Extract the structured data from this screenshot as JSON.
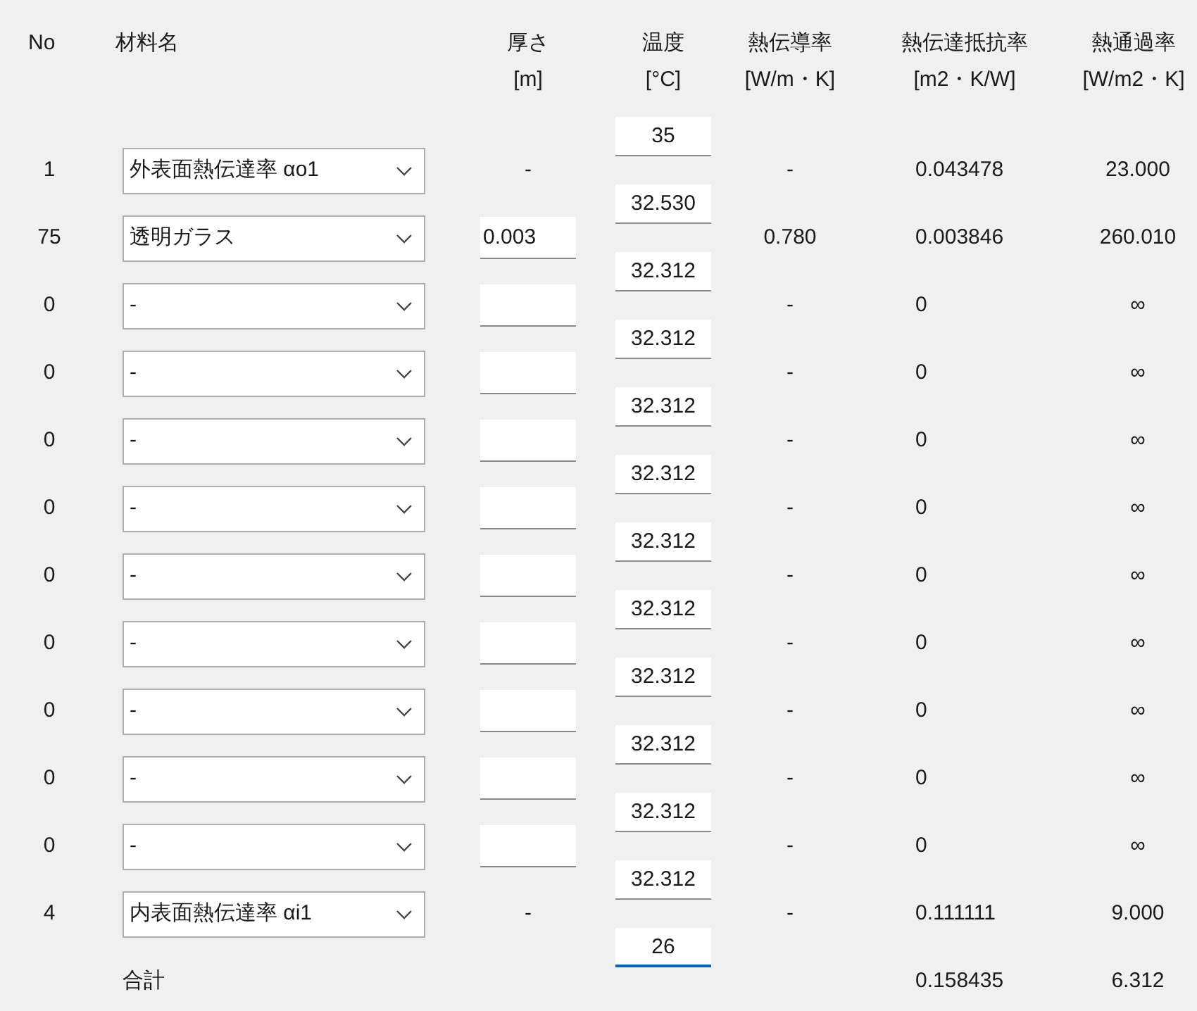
{
  "headers": [
    {
      "lines": [
        "No"
      ]
    },
    {
      "lines": [
        "材料名"
      ]
    },
    {
      "lines": [
        "厚さ",
        "[m]"
      ]
    },
    {
      "lines": [
        "温度",
        "[°C]"
      ]
    },
    {
      "lines": [
        "熱伝導率",
        "[W/m・K]"
      ]
    },
    {
      "lines": [
        "熱伝達抵抗率",
        "[m2・K/W]"
      ]
    },
    {
      "lines": [
        "熱通過率",
        "[W/m2・K]"
      ]
    }
  ],
  "rows": [
    {
      "no": "1",
      "material": "外表面熱伝達率 αo1",
      "thickness": {
        "kind": "text",
        "value": "-"
      },
      "conductivity": "-",
      "resistance": "0.043478",
      "transmittance": "23.000"
    },
    {
      "no": "75",
      "material": "透明ガラス",
      "thickness": {
        "kind": "input",
        "value": "0.003"
      },
      "conductivity": "0.780",
      "resistance": "0.003846",
      "transmittance": "260.010"
    },
    {
      "no": "0",
      "material": "-",
      "thickness": {
        "kind": "input"
      },
      "conductivity": "-",
      "resistance": "0",
      "transmittance": "∞"
    },
    {
      "no": "0",
      "material": "-",
      "thickness": {
        "kind": "input"
      },
      "conductivity": "-",
      "resistance": "0",
      "transmittance": "∞"
    },
    {
      "no": "0",
      "material": "-",
      "thickness": {
        "kind": "input"
      },
      "conductivity": "-",
      "resistance": "0",
      "transmittance": "∞"
    },
    {
      "no": "0",
      "material": "-",
      "thickness": {
        "kind": "input"
      },
      "conductivity": "-",
      "resistance": "0",
      "transmittance": "∞"
    },
    {
      "no": "0",
      "material": "-",
      "thickness": {
        "kind": "input"
      },
      "conductivity": "-",
      "resistance": "0",
      "transmittance": "∞"
    },
    {
      "no": "0",
      "material": "-",
      "thickness": {
        "kind": "input"
      },
      "conductivity": "-",
      "resistance": "0",
      "transmittance": "∞"
    },
    {
      "no": "0",
      "material": "-",
      "thickness": {
        "kind": "input"
      },
      "conductivity": "-",
      "resistance": "0",
      "transmittance": "∞"
    },
    {
      "no": "0",
      "material": "-",
      "thickness": {
        "kind": "input"
      },
      "conductivity": "-",
      "resistance": "0",
      "transmittance": "∞"
    },
    {
      "no": "0",
      "material": "-",
      "thickness": {
        "kind": "input"
      },
      "conductivity": "-",
      "resistance": "0",
      "transmittance": "∞"
    },
    {
      "no": "4",
      "material": "内表面熱伝達率 αi1",
      "thickness": {
        "kind": "text",
        "value": "-"
      },
      "conductivity": "-",
      "resistance": "0.111111",
      "transmittance": "9.000"
    }
  ],
  "temperatures": [
    {
      "value": "35",
      "focused": false
    },
    {
      "value": "32.530",
      "focused": false
    },
    {
      "value": "32.312",
      "focused": false
    },
    {
      "value": "32.312",
      "focused": false
    },
    {
      "value": "32.312",
      "focused": false
    },
    {
      "value": "32.312",
      "focused": false
    },
    {
      "value": "32.312",
      "focused": false
    },
    {
      "value": "32.312",
      "focused": false
    },
    {
      "value": "32.312",
      "focused": false
    },
    {
      "value": "32.312",
      "focused": false
    },
    {
      "value": "32.312",
      "focused": false
    },
    {
      "value": "32.312",
      "focused": false
    },
    {
      "value": "26",
      "focused": true
    }
  ],
  "total": {
    "label": "合計",
    "resistance": "0.158435",
    "transmittance": "6.312"
  }
}
